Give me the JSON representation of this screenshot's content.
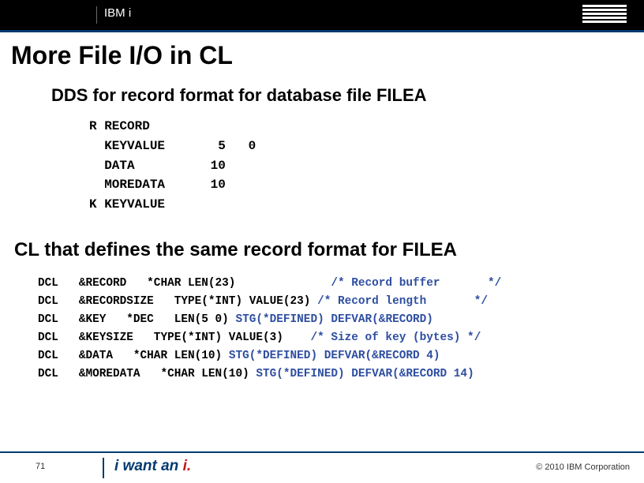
{
  "header": {
    "brandline": "IBM i"
  },
  "title": "More File I/O in CL",
  "subtitle1": "DDS for record format for database file FILEA",
  "dds": {
    "l1": "R RECORD",
    "l2": "  KEYVALUE       5   0",
    "l3": "  DATA          10",
    "l4": "  MOREDATA      10",
    "l5": "K KEYVALUE"
  },
  "subtitle2": "CL that defines the same record format for FILEA",
  "cl": {
    "r1a": "DCL   &RECORD   *CHAR LEN(23)              ",
    "r1b": "/* Record buffer       */",
    "r2a": "DCL   &RECORDSIZE   TYPE(*INT) VALUE(23) ",
    "r2b": "/* Record length       */",
    "r3a": "DCL   &KEY   *DEC   LEN(5 0) ",
    "r3b": "STG(*DEFINED) DEFVAR(&RECORD)",
    "r4a": "DCL   &KEYSIZE   TYPE(*INT) VALUE(3)    ",
    "r4b": "/* Size of key (bytes) */",
    "r5a": "DCL   &DATA   *CHAR LEN(10) ",
    "r5b": "STG(*DEFINED) DEFVAR(&RECORD 4)",
    "r6a": "DCL   &MOREDATA   *CHAR LEN(10) ",
    "r6b": "STG(*DEFINED) DEFVAR(&RECORD 14)"
  },
  "footer": {
    "page": "71",
    "tag_pre": "i want an ",
    "tag_i": "i.",
    "copyright": "© 2010 IBM Corporation"
  }
}
